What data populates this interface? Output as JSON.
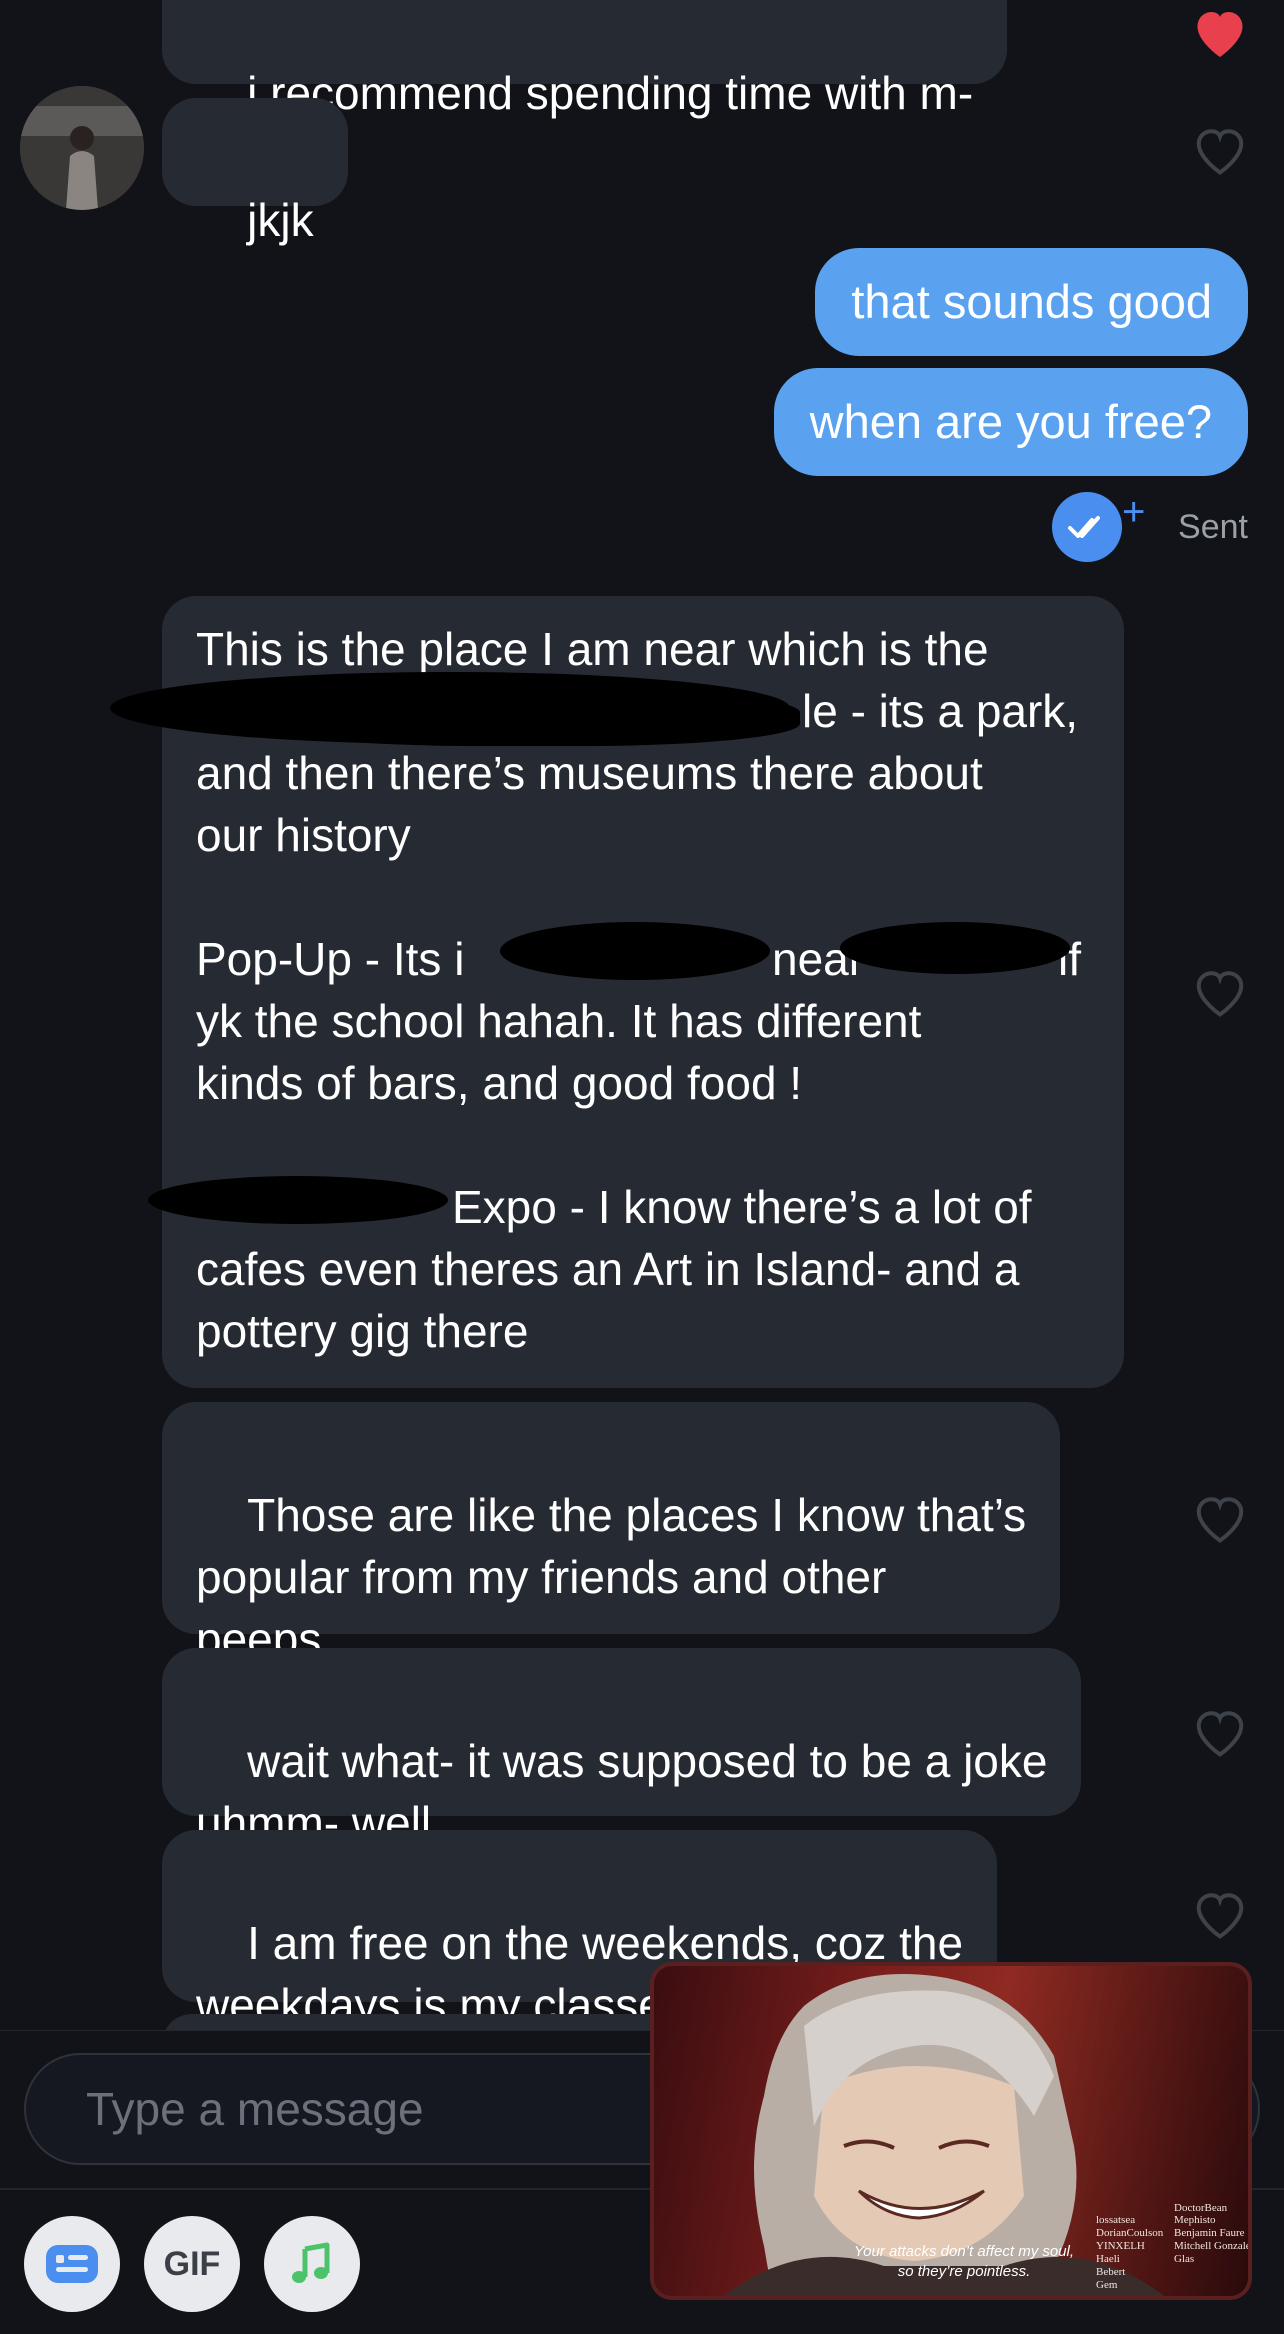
{
  "messages": [
    {
      "id": "m1",
      "side": "in",
      "text": "i recommend spending time with m-",
      "liked": true
    },
    {
      "id": "m2",
      "side": "in",
      "text": "jkjk",
      "liked": false
    },
    {
      "id": "m3",
      "side": "out",
      "text": "that sounds good"
    },
    {
      "id": "m4",
      "side": "out",
      "text": "when are you free?"
    },
    {
      "id": "m5",
      "side": "in",
      "paragraphs": [
        "This is the place I am near which is the",
        "le - its a park,",
        "and then there’s museums there about",
        "our history",
        "Pop-Up - Its i",
        "near",
        "if",
        "yk the school hahah. It has different",
        "kinds of bars, and good food !",
        "Expo - I know there’s a lot of",
        "cafes even theres an Art in Island- and a",
        "pottery gig there"
      ],
      "liked": false
    },
    {
      "id": "m6",
      "side": "in",
      "text": "Those are like the places I know that’s\npopular from my friends and other\npeeps",
      "liked": false
    },
    {
      "id": "m7",
      "side": "in",
      "text": "wait what- it was supposed to be a joke\nuhmm- well",
      "liked": false
    },
    {
      "id": "m8",
      "side": "in",
      "text": "I am free on the weekends, coz the\nweekdays is my classes 😢",
      "liked": false
    }
  ],
  "status": {
    "sent_label": "Sent"
  },
  "composer": {
    "placeholder": "Type a message",
    "gif_label": "GIF"
  },
  "pip": {
    "caption_line1": "Your attacks don’t affect my soul,",
    "caption_line2": "so they’re pointless.",
    "credits_col1": "Mephisto\nBenjamin Faure\nMitchell Gonzales\nGlas",
    "credits_col2": "lossatsea\nDorianCoulson\nYINXELH\nHaeli\nBebert\nGem",
    "credits_col3": "DoctorBean"
  },
  "colors": {
    "outgoing": "#5aa2f0",
    "incoming": "#262a32",
    "liked_heart": "#e8414d",
    "read_badge": "#4a8ef0"
  },
  "icons": [
    "heart-filled-icon",
    "heart-outline-icon",
    "double-check-icon",
    "plus-icon",
    "contact-card-icon",
    "music-note-icon"
  ]
}
